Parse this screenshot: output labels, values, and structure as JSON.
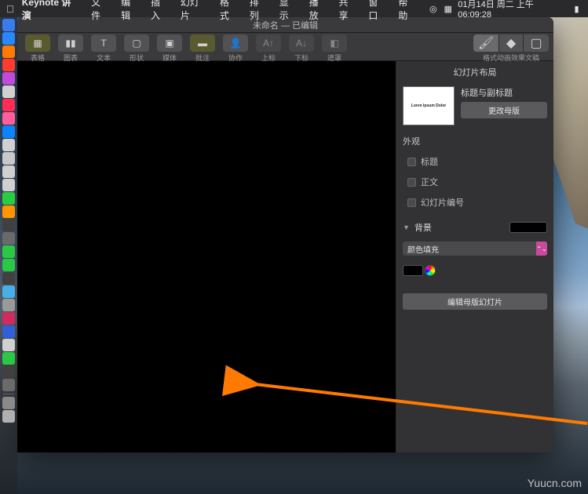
{
  "menubar": {
    "app_name": "Keynote 讲演",
    "items": [
      "文件",
      "编辑",
      "插入",
      "幻灯片",
      "格式",
      "排列",
      "显示",
      "播放",
      "共享",
      "窗口",
      "帮助"
    ],
    "datetime": "01月14日 周二 上午06:09:28"
  },
  "window": {
    "title": "未命名 — 已编辑"
  },
  "toolbar": {
    "items": [
      {
        "label": "表格",
        "icon": "table-icon"
      },
      {
        "label": "图表",
        "icon": "chart-icon"
      },
      {
        "label": "文本",
        "icon": "text-icon"
      },
      {
        "label": "形状",
        "icon": "shape-icon"
      },
      {
        "label": "媒体",
        "icon": "media-icon"
      },
      {
        "label": "批注",
        "icon": "comment-icon"
      },
      {
        "label": "协作",
        "icon": "collab-icon"
      },
      {
        "label": "上标",
        "icon": "superscript-icon"
      },
      {
        "label": "下标",
        "icon": "subscript-icon"
      },
      {
        "label": "遮罩",
        "icon": "mask-icon"
      }
    ],
    "right": [
      {
        "label": "格式",
        "icon": "format-icon"
      },
      {
        "label": "动画效果",
        "icon": "animate-icon"
      },
      {
        "label": "文稿",
        "icon": "document-icon"
      }
    ]
  },
  "inspector": {
    "header": "幻灯片布局",
    "thumb": {
      "line1": "Loren Ipsum Dolor",
      "line2": ""
    },
    "layout_name": "标题与副标题",
    "change_master_btn": "更改母版",
    "appearance_label": "外观",
    "checks": {
      "title": "标题",
      "body": "正文",
      "number": "幻灯片编号"
    },
    "background_label": "背景",
    "fill_select": "颜色填充",
    "edit_master_btn": "编辑母版幻灯片"
  },
  "watermark": "Yuucn.com",
  "dock_colors": [
    "#3a7cf0",
    "#2a88ff",
    "#ff7a00",
    "#ff3b30",
    "#c04bd8",
    "#d0d0d0",
    "#ff2d55",
    "#ff5e9a",
    "#0a84ff",
    "#d0d0d0",
    "#c8c8c8",
    "#d0d0d0",
    "#d0d0d0",
    "#28cd41",
    "#ff9500",
    "#404040",
    "#6a6a6a",
    "#2ac845",
    "#2ac845",
    "#404040",
    "#46b0e6",
    "#9a9a9a",
    "#d02a5e",
    "#2f60d8",
    "#d0d0d0",
    "#2ac845",
    "#404040",
    "#6a6a6a",
    "#8a8a8a",
    "#b0b0b0"
  ]
}
